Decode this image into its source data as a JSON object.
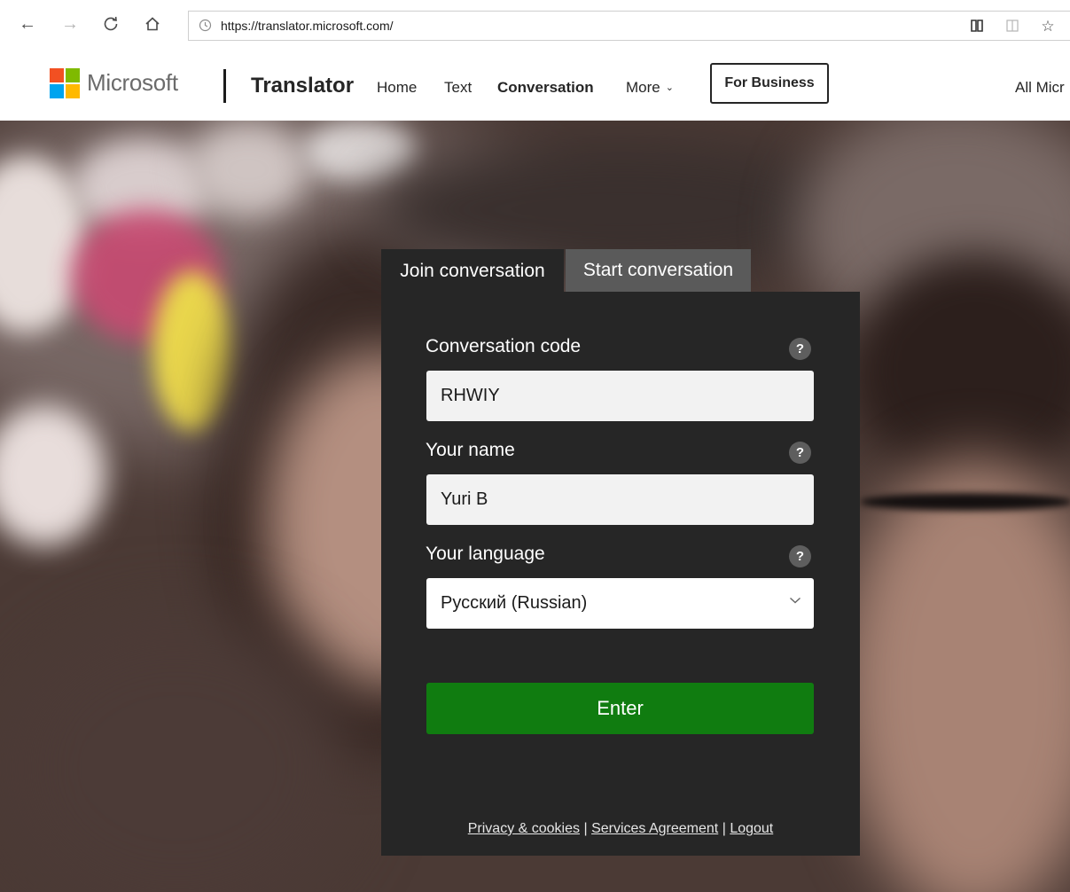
{
  "browser": {
    "url": "https://translator.microsoft.com/",
    "icons": [
      "back-arrow-icon",
      "forward-arrow-icon",
      "refresh-icon",
      "home-icon",
      "clock-icon",
      "reading-view-icon",
      "tab-icon",
      "favorite-star-icon"
    ]
  },
  "header": {
    "brand": "Microsoft",
    "app_name": "Translator",
    "nav": [
      {
        "label": "Home"
      },
      {
        "label": "Text"
      },
      {
        "label": "Conversation"
      },
      {
        "label": "More"
      }
    ],
    "business_label": "For Business",
    "all_microsoft": "All Micr"
  },
  "tabs": {
    "join": "Join conversation",
    "start": "Start conversation"
  },
  "form": {
    "code_label": "Conversation code",
    "code_value": "RHWIY",
    "name_label": "Your name",
    "name_value": "Yuri B",
    "language_label": "Your language",
    "language_value": "Русский (Russian)",
    "help_glyph": "?",
    "enter_label": "Enter"
  },
  "footer": {
    "privacy": "Privacy & cookies",
    "agreement": "Services Agreement",
    "logout": "Logout",
    "separator": "|"
  },
  "colors": {
    "ms_red": "#f25022",
    "ms_green": "#7fba00",
    "ms_blue": "#00a4ef",
    "ms_yellow": "#ffb900",
    "enter_green": "#107c10",
    "card_bg": "#262626"
  }
}
